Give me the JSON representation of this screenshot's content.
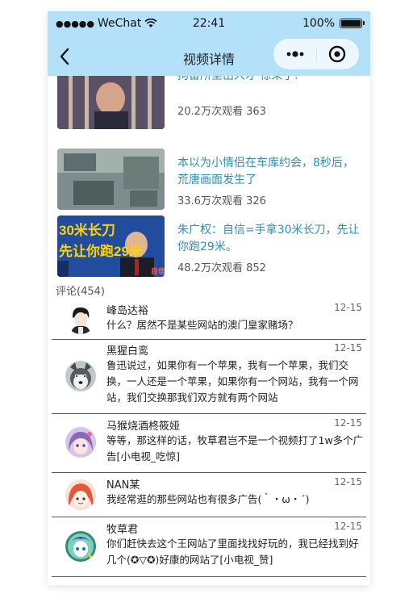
{
  "status_bar": {
    "signal": "●●●●●",
    "carrier": "WeChat",
    "time": "22:41",
    "battery": "100%",
    "battery_level": 1.0
  },
  "nav": {
    "title": "视频详情",
    "back_icon": "chevron-left-icon",
    "more_icon": "more-dots-icon",
    "close_icon": "target-icon"
  },
  "videos": [
    {
      "title": "拘留所里出人才 惊呆了!",
      "stats": "20.2万次观看 363"
    },
    {
      "title": "本以为小情侣在车库约会，8秒后，荒唐画面发生了",
      "stats": "33.6万次观看 326"
    },
    {
      "title": "朱广权：自信=手拿30米长刀，先让你跑29米。",
      "stats": "48.2万次观看 852",
      "thumb_text_line1": "30米长刀",
      "thumb_text_line2": "先让你跑29米",
      "thumb_badge": "自信"
    }
  ],
  "comments_header": "评论(454)",
  "comments": [
    {
      "name": "峰岛达裕",
      "date": "12-15",
      "text": "什么？居然不是某些网站的澳门皇家赌场？"
    },
    {
      "name": "黑猩白鸾",
      "date": "12-15",
      "text": "鲁迅说过，如果你有一个苹果，我有一个苹果，我们交换，一人还是一个苹果，如果你有一个网站，我有一个网站，我们交换那我们双方就有两个网站"
    },
    {
      "name": "马猴烧酒柊筱娅",
      "date": "12-15",
      "text": "等等，那这样的话，牧草君岂不是一个视频打了1w多个广告[小电视_吃惊]"
    },
    {
      "name": "NAN某",
      "date": "12-15",
      "text": "我经常逛的那些网站也有很多广告(｀・ω・´)"
    },
    {
      "name": "牧草君",
      "date": "12-15",
      "text": "你们赶快去这个王网站了里面找找好玩的，我已经找到好几个(✪▽✪)好康的网站了[小电视_赞]"
    }
  ],
  "colors": {
    "header_bg": "#b3e1fa",
    "link_blue": "#2e8fb4",
    "divider": "#555555"
  }
}
